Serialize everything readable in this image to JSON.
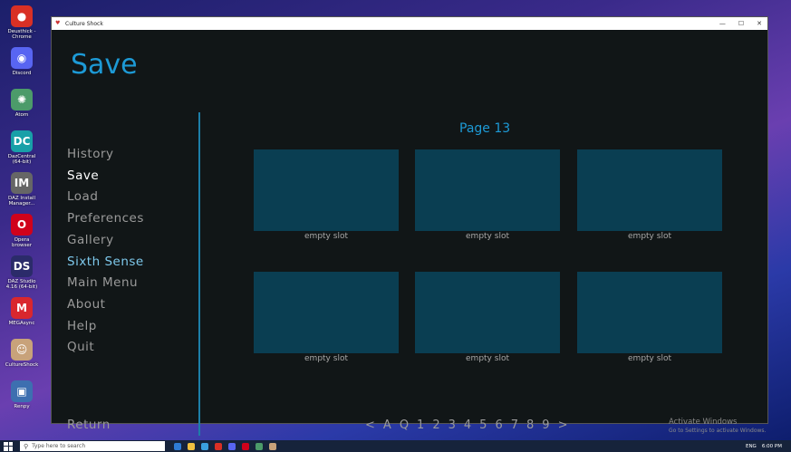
{
  "desktop": {
    "icons": [
      {
        "label": "Deusthick -\nChrome",
        "icon": "chrome-icon",
        "color": "#d93025",
        "glyph": "●"
      },
      {
        "label": "Discord",
        "icon": "discord-icon",
        "color": "#5865f2",
        "glyph": "◉"
      },
      {
        "label": "Atom",
        "icon": "atom-icon",
        "color": "#4c9b6a",
        "glyph": "✺"
      },
      {
        "label": "DazCentral\n(64-bit)",
        "icon": "dazcentral-icon",
        "color": "#18a0a8",
        "glyph": "DC"
      },
      {
        "label": "DAZ Install\nManager...",
        "icon": "daz-install-icon",
        "color": "#666",
        "glyph": "IM"
      },
      {
        "label": "Opera\nbrowser",
        "icon": "opera-icon",
        "color": "#d0021b",
        "glyph": "O"
      },
      {
        "label": "DAZ Studio\n4.16 (64-bit)",
        "icon": "daz-studio-icon",
        "color": "#2b2b6a",
        "glyph": "DS"
      },
      {
        "label": "MEGAsync",
        "icon": "mega-icon",
        "color": "#d9272e",
        "glyph": "M"
      },
      {
        "label": "CultureShock",
        "icon": "game-icon",
        "color": "#c8a27a",
        "glyph": "☺"
      },
      {
        "label": "Renpy",
        "icon": "renpy-icon",
        "color": "#3d6fb0",
        "glyph": "▣"
      }
    ]
  },
  "window": {
    "title": "Culture Shock",
    "controls": {
      "minimize": "—",
      "maximize": "☐",
      "close": "✕"
    }
  },
  "game": {
    "screen_title": "Save",
    "menu": [
      {
        "label": "History",
        "state": "normal"
      },
      {
        "label": "Save",
        "state": "selected"
      },
      {
        "label": "Load",
        "state": "normal"
      },
      {
        "label": "Preferences",
        "state": "normal"
      },
      {
        "label": "Gallery",
        "state": "normal"
      },
      {
        "label": "Sixth Sense",
        "state": "special"
      },
      {
        "label": "Main Menu",
        "state": "normal"
      },
      {
        "label": "About",
        "state": "normal"
      },
      {
        "label": "Help",
        "state": "normal"
      },
      {
        "label": "Quit",
        "state": "normal"
      }
    ],
    "return_label": "Return",
    "page_label": "Page 13",
    "slots": [
      {
        "caption": "empty slot"
      },
      {
        "caption": "empty slot"
      },
      {
        "caption": "empty slot"
      },
      {
        "caption": "empty slot"
      },
      {
        "caption": "empty slot"
      },
      {
        "caption": "empty slot"
      }
    ],
    "pager": [
      "<",
      "A",
      "Q",
      "1",
      "2",
      "3",
      "4",
      "5",
      "6",
      "7",
      "8",
      "9",
      ">"
    ],
    "watermark": {
      "line1": "Activate Windows",
      "line2": "Go to Settings to activate Windows."
    },
    "colors": {
      "accent": "#1d9ad6",
      "slot": "#0a3e52",
      "special": "#7ec9ec"
    }
  },
  "taskbar": {
    "search_placeholder": "Type here to search",
    "tray_lang": "ENG",
    "clock": "6:00 PM"
  }
}
